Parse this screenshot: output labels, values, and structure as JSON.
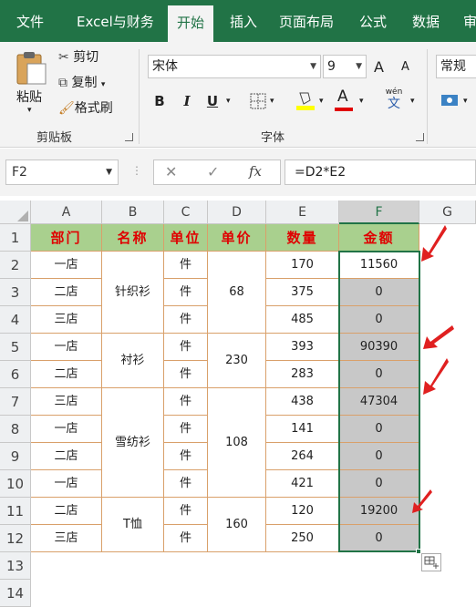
{
  "menu_tabs": [
    "文件",
    "Excel与财务",
    "开始",
    "插入",
    "页面布局",
    "公式",
    "数据",
    "审"
  ],
  "active_tab": "开始",
  "clipboard": {
    "paste": "粘贴",
    "cut": "剪切",
    "copy": "复制",
    "format_painter": "格式刷",
    "group": "剪贴板"
  },
  "font": {
    "name": "宋体",
    "size": "9",
    "bold": "B",
    "italic": "I",
    "underline": "U",
    "grow": "A",
    "shrink": "A",
    "wen": "wén",
    "wen_char": "文",
    "group": "字体",
    "font_color": "A"
  },
  "number": {
    "format": "常规"
  },
  "formula_bar": {
    "name_box": "F2",
    "cancel": "✕",
    "enter": "✓",
    "fx": "fx",
    "formula": "=D2*E2"
  },
  "columns": [
    "A",
    "B",
    "C",
    "D",
    "E",
    "F",
    "G"
  ],
  "rows": [
    "1",
    "2",
    "3",
    "4",
    "5",
    "6",
    "7",
    "8",
    "9",
    "10",
    "11",
    "12",
    "13",
    "14"
  ],
  "headers": [
    "部门",
    "名称",
    "单位",
    "单价",
    "数量",
    "金额"
  ],
  "dept": [
    "一店",
    "二店",
    "三店",
    "一店",
    "二店",
    "三店",
    "一店",
    "二店",
    "一店",
    "二店",
    "三店"
  ],
  "names": [
    "针织衫",
    "衬衫",
    "雪纺衫",
    "T恤"
  ],
  "unit": "件",
  "prices": [
    "68",
    "230",
    "108",
    "160"
  ],
  "qty": [
    "170",
    "375",
    "485",
    "393",
    "283",
    "438",
    "141",
    "264",
    "421",
    "120",
    "250"
  ],
  "amount": [
    "11560",
    "0",
    "0",
    "90390",
    "0",
    "47304",
    "0",
    "0",
    "0",
    "19200",
    "0"
  ],
  "colors": {
    "ribbon_green": "#217346",
    "header_fill": "#a9d08e",
    "header_text": "#e00000",
    "arrow": "#e02020",
    "selection": "#217346"
  }
}
